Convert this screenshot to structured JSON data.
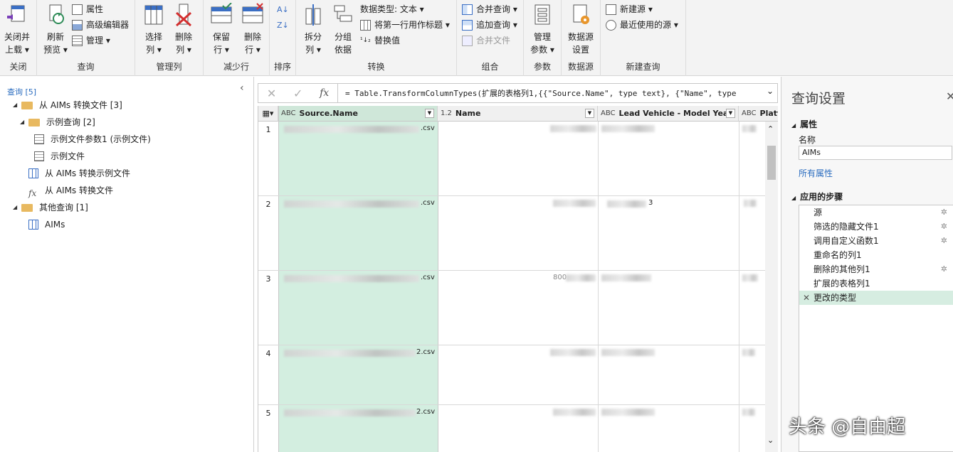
{
  "ribbon": {
    "groups": {
      "close": "关闭",
      "query": "查询",
      "manage_cols": "管理列",
      "reduce_rows": "减少行",
      "sort": "排序",
      "transform": "转换",
      "combine": "组合",
      "params": "参数",
      "datasource": "数据源",
      "new_query": "新建查询"
    },
    "close_load": [
      "关闭并",
      "上载 ▾"
    ],
    "refresh_preview": [
      "刷新",
      "预览 ▾"
    ],
    "properties": "属性",
    "advanced_editor": "高级编辑器",
    "manage": "管理 ▾",
    "choose_cols": [
      "选择",
      "列 ▾"
    ],
    "remove_cols": [
      "删除",
      "列 ▾"
    ],
    "keep_rows": [
      "保留",
      "行 ▾"
    ],
    "remove_rows": [
      "删除",
      "行 ▾"
    ],
    "split_col": [
      "拆分",
      "列 ▾"
    ],
    "group_by": [
      "分组",
      "依据"
    ],
    "data_type": "数据类型: 文本 ▾",
    "first_row_header": "将第一行用作标题 ▾",
    "replace_values": "替换值",
    "merge_queries": "合并查询 ▾",
    "append_queries": "追加查询 ▾",
    "combine_files": "合并文件",
    "manage_params": [
      "管理",
      "参数 ▾"
    ],
    "datasource_settings": [
      "数据源",
      "设置"
    ],
    "new_source": "新建源 ▾",
    "recent_sources": "最近使用的源 ▾"
  },
  "queries": {
    "header": "查询 [5]",
    "tree": [
      {
        "label": "从 AIMs 转换文件 [3]"
      },
      {
        "label": "示例查询 [2]"
      },
      {
        "label": "示例文件参数1 (示例文件)"
      },
      {
        "label": "示例文件"
      },
      {
        "label": "从 AIMs 转换示例文件"
      },
      {
        "label": "从 AIMs 转换文件"
      },
      {
        "label": "其他查询 [1]"
      },
      {
        "label": "AIMs"
      }
    ]
  },
  "formula": {
    "text": "= Table.TransformColumnTypes(扩展的表格列1,{{\"Source.Name\", type text}, {\"Name\", type"
  },
  "grid": {
    "columns": [
      {
        "type": "ABC",
        "name": "Source.Name"
      },
      {
        "type": "1.2",
        "name": "Name"
      },
      {
        "type": "ABC",
        "name": "Lead Vehicle - Model Year"
      },
      {
        "type": "ABC",
        "name": "Platfo"
      }
    ],
    "rows": [
      {
        "num": "1",
        "suffix": ".csv",
        "extra": ""
      },
      {
        "num": "2",
        "suffix": ".csv",
        "extra": "3"
      },
      {
        "num": "3",
        "suffix": ".csv",
        "extra": "800"
      },
      {
        "num": "4",
        "suffix": "2.csv",
        "extra": ""
      },
      {
        "num": "5",
        "suffix": "2.csv",
        "extra": ""
      }
    ]
  },
  "settings": {
    "title": "查询设置",
    "properties": "属性",
    "name_label": "名称",
    "name_value": "AIMs",
    "all_properties": "所有属性",
    "applied_steps": "应用的步骤",
    "steps": [
      {
        "label": "源",
        "gear": true
      },
      {
        "label": "筛选的隐藏文件1",
        "gear": true
      },
      {
        "label": "调用自定义函数1",
        "gear": true
      },
      {
        "label": "重命名的列1",
        "gear": false
      },
      {
        "label": "删除的其他列1",
        "gear": true
      },
      {
        "label": "扩展的表格列1",
        "gear": false
      },
      {
        "label": "更改的类型",
        "gear": false,
        "selected": true
      }
    ]
  },
  "watermark": "头条 @自由超",
  "colors": {
    "accent": "#2a6cbf",
    "selected_col": "#d3eee0",
    "selected_step": "#d6ede1"
  }
}
